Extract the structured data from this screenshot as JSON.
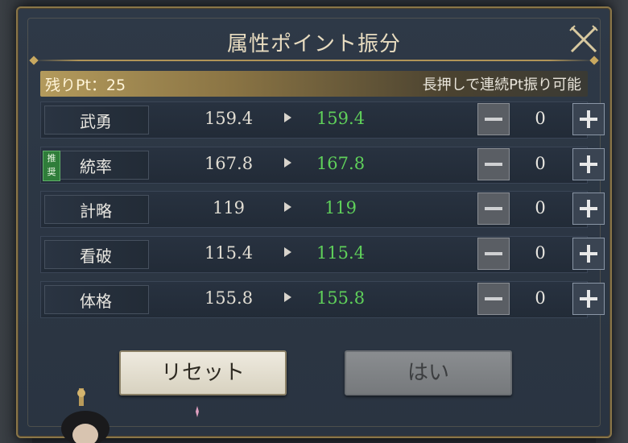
{
  "dialog": {
    "title": "属性ポイント振分",
    "close_icon": "crossed-swords-close-icon"
  },
  "points": {
    "label": "残りPt：25",
    "remaining": 25,
    "hint": "長押しで連続Pt振り可能"
  },
  "stats": [
    {
      "name": "武勇",
      "current": "159.4",
      "new": "159.4",
      "qty": "0",
      "recommended": false
    },
    {
      "name": "統率",
      "current": "167.8",
      "new": "167.8",
      "qty": "0",
      "recommended": true
    },
    {
      "name": "計略",
      "current": "119",
      "new": "119",
      "qty": "0",
      "recommended": false
    },
    {
      "name": "看破",
      "current": "115.4",
      "new": "115.4",
      "qty": "0",
      "recommended": false
    },
    {
      "name": "体格",
      "current": "155.8",
      "new": "155.8",
      "qty": "0",
      "recommended": false
    }
  ],
  "recommend_badge": "推奨",
  "buttons": {
    "reset": "リセット",
    "ok": "はい"
  },
  "colors": {
    "gold_frame": "#8a7648",
    "new_value_green": "#5fd05a",
    "panel_bg": "#2e3947"
  }
}
